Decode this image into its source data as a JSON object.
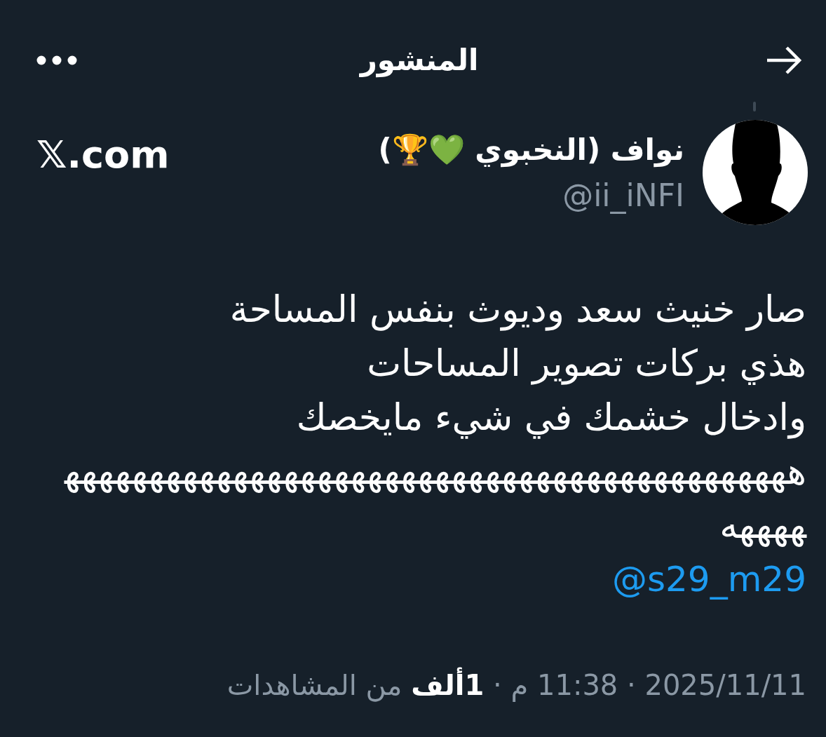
{
  "header": {
    "title": "المنشور"
  },
  "post": {
    "author": {
      "name": "نواف (النخبوي 💚🏆)",
      "handle": "@ii_iNFI"
    },
    "source": "𝕏.com",
    "text": "صار خنيث سعد وديوث بنفس المساحة\nهذي بركات تصوير المساحات\nوادخال خشمك في شيء مايخصك\nههههههههههههههههههههههههههههههههههههههههههههههههه",
    "mention": "@s29_m29",
    "meta": "2025/11/11 · 11:38 م · **1ألف** من المشاهدات"
  }
}
